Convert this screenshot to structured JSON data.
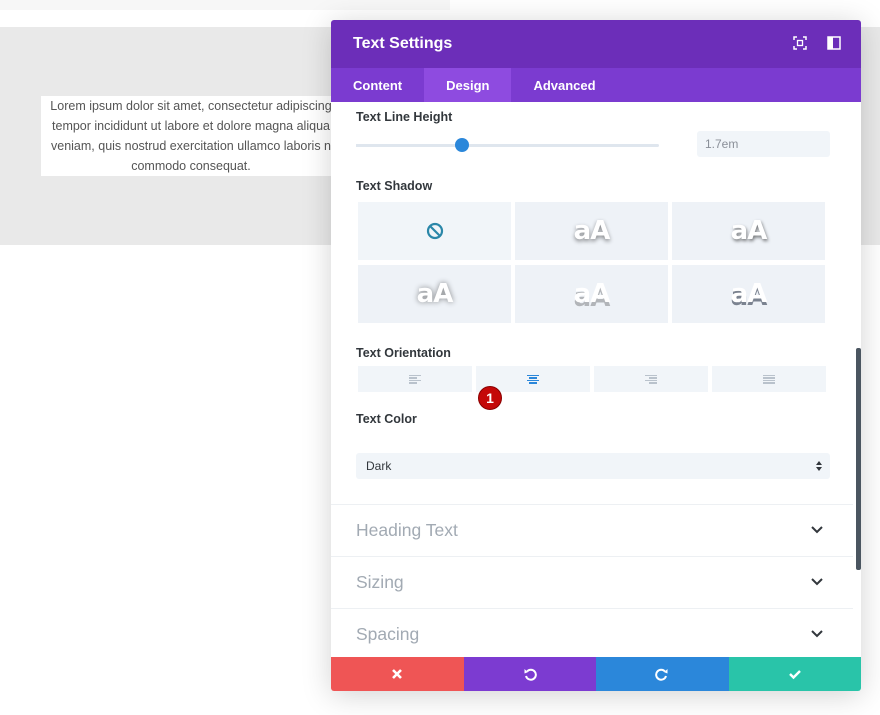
{
  "background_page": {
    "text_lines": [
      "Lorem ipsum dolor sit amet, consectetur adipiscing",
      "tempor incididunt ut labore et dolore magna aliqua",
      "veniam, quis nostrud exercitation ullamco laboris n",
      "commodo consequat."
    ]
  },
  "modal": {
    "title": "Text Settings",
    "header_icons": [
      "fullscreen-icon",
      "sidebar-toggle-icon"
    ],
    "tabs": [
      {
        "label": "Content",
        "active": false
      },
      {
        "label": "Design",
        "active": true
      },
      {
        "label": "Advanced",
        "active": false
      }
    ],
    "line_height": {
      "label": "Text Line Height",
      "value": "1.7em",
      "slider_fraction": 0.35
    },
    "text_shadow": {
      "label": "Text Shadow",
      "options": [
        "none",
        "aA",
        "aA",
        "aA",
        "aA",
        "aA"
      ]
    },
    "text_orientation": {
      "label": "Text Orientation",
      "options": [
        "left",
        "center",
        "right",
        "justify"
      ],
      "selected": "center",
      "badge": "1"
    },
    "text_color": {
      "label": "Text Color",
      "value": "Dark"
    },
    "sections": [
      {
        "title": "Heading Text"
      },
      {
        "title": "Sizing"
      },
      {
        "title": "Spacing"
      }
    ],
    "footer": {
      "buttons": [
        "cancel",
        "undo",
        "redo",
        "save"
      ]
    }
  },
  "colors": {
    "header": "#6c2eb9",
    "tabs": "#7b3bd0",
    "active_tab": "#8e4be0",
    "accent_blue": "#2b87da",
    "cancel": "#ef5555",
    "undo": "#7c3bd1",
    "redo": "#2b87da",
    "save": "#29c4a9",
    "badge": "#c40808"
  }
}
